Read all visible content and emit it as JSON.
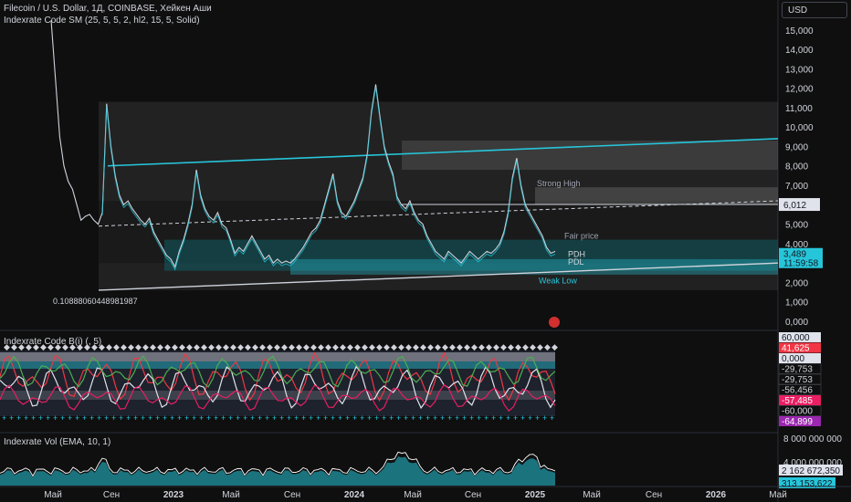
{
  "header": {
    "title": "Filecoin / U.S. Dollar, 1Д, COINBASE, Хейкен Аши",
    "indicator": "Indexrate Code SM (25, 5, 5, 2, hl2, 15, 5, Solid)",
    "currency_button": "USD"
  },
  "panes": {
    "osc_title": "Indexrate Code B(i) (, 5)",
    "vol_title": "Indexrate Vol (EMA, 10, 1)"
  },
  "colors": {
    "background": "#0f0f0f",
    "teal": "#26c6da",
    "teal_fill": "#0e6b72",
    "gray_zone": "#6b6b6b",
    "red": "#f23645",
    "green": "#4caf50",
    "magenta": "#e91e63",
    "purple": "#9c27b0",
    "white": "#e0e3eb"
  },
  "chart_data": [
    {
      "type": "line",
      "name": "price",
      "y_axis_ticks": [
        "15,000",
        "14,000",
        "13,000",
        "12,000",
        "11,000",
        "10,000",
        "9,000",
        "8,000",
        "7,000",
        "6,000",
        "5,000",
        "4,000",
        "3,000",
        "2,000",
        "1,000",
        "0,000"
      ],
      "x_axis_ticks": [
        "Май",
        "Сен",
        "2023",
        "Май",
        "Сен",
        "2024",
        "Май",
        "Сен",
        "2025",
        "Май",
        "Сен",
        "2026",
        "Май"
      ],
      "bold_ticks": [
        "2023",
        "2024",
        "2025",
        "2026"
      ],
      "x": [
        0,
        1,
        2,
        3,
        4,
        5,
        6,
        7,
        8,
        9,
        10,
        11,
        12,
        13,
        14,
        15,
        16,
        17,
        18,
        19,
        20,
        21,
        22,
        23,
        24,
        25,
        26,
        27,
        28,
        29,
        30,
        31,
        32,
        33,
        34,
        35,
        36,
        37,
        38,
        39,
        40,
        41,
        42,
        43,
        44,
        45,
        46,
        47,
        48,
        49,
        50,
        51,
        52,
        53,
        54,
        55,
        56,
        57,
        58,
        59,
        60,
        61,
        62,
        63,
        64,
        65,
        66,
        67,
        68,
        69,
        70,
        71,
        72,
        73,
        74,
        75,
        76,
        77,
        78,
        79,
        80,
        81,
        82,
        83,
        84,
        85,
        86,
        87,
        88,
        89,
        90,
        91,
        92,
        93,
        94,
        95,
        96,
        97,
        98,
        99,
        100,
        101,
        102,
        103,
        104,
        105,
        106,
        107,
        108,
        109,
        110,
        111,
        112,
        113,
        114,
        115,
        116,
        117,
        118,
        119,
        120,
        121,
        122,
        123,
        124,
        125,
        126,
        127,
        128,
        129,
        130,
        131,
        132,
        133,
        134,
        135,
        136
      ],
      "values": [
        15.5,
        12.5,
        9.5,
        8.0,
        7.2,
        6.8,
        6.0,
        5.2,
        5.4,
        5.5,
        5.2,
        5.0,
        5.6,
        11.2,
        9.0,
        7.5,
        6.5,
        6.0,
        6.2,
        5.8,
        5.5,
        5.2,
        5.0,
        5.3,
        4.6,
        4.2,
        3.8,
        3.4,
        3.2,
        2.8,
        3.6,
        4.2,
        5.0,
        6.0,
        7.8,
        6.5,
        5.8,
        5.4,
        5.2,
        5.6,
        5.0,
        4.8,
        4.2,
        3.5,
        3.8,
        3.6,
        4.0,
        4.4,
        4.0,
        3.6,
        3.2,
        3.4,
        3.0,
        3.2,
        3.0,
        3.1,
        3.0,
        3.2,
        3.5,
        3.8,
        4.2,
        4.6,
        4.8,
        5.2,
        6.0,
        6.8,
        7.6,
        6.2,
        5.6,
        5.4,
        5.8,
        6.2,
        6.8,
        7.4,
        8.6,
        10.8,
        12.2,
        10.5,
        9.0,
        8.2,
        7.6,
        6.4,
        6.0,
        5.8,
        6.2,
        5.6,
        5.2,
        5.0,
        4.4,
        4.0,
        3.6,
        3.4,
        3.2,
        3.6,
        3.4,
        3.2,
        3.0,
        3.3,
        3.6,
        3.4,
        3.2,
        3.4,
        3.6,
        3.5,
        3.7,
        4.0,
        4.6,
        5.6,
        7.4,
        8.4,
        7.0,
        6.0,
        5.6,
        5.2,
        4.8,
        4.4,
        3.8,
        3.5,
        3.6
      ],
      "ylim": [
        0,
        15.6
      ],
      "annotations": {
        "strong_high": "Strong High",
        "fair_price": "Fair price",
        "weak_low": "Weak Low",
        "pdh": "PDH",
        "pdl": "PDL",
        "low_value": "0.10888060448981987",
        "level_6012": "6,012",
        "last_price": "3,489",
        "countdown": "11:59:58"
      }
    },
    {
      "type": "line",
      "name": "oscillator",
      "y_axis_ticks": [
        "60,000",
        "41,625",
        "0,000",
        "-29,753",
        "-29,753",
        "-56,456",
        "-57,485",
        "-60,000",
        "-64,899"
      ],
      "badge_ticks": [
        "60,000",
        "41,625",
        "0,000",
        "-29,753",
        "-29,753",
        "-56,456",
        "-57,485",
        "-60,000",
        "-64,899"
      ],
      "ylim": [
        -65,
        60
      ]
    },
    {
      "type": "area",
      "name": "volume",
      "y_axis_ticks": [
        "8 000 000 000",
        "4 000 000 000"
      ],
      "badge_ticks": [
        "2 162 672,350",
        "313 153,622"
      ],
      "ylim": [
        0,
        8000000000
      ]
    }
  ]
}
